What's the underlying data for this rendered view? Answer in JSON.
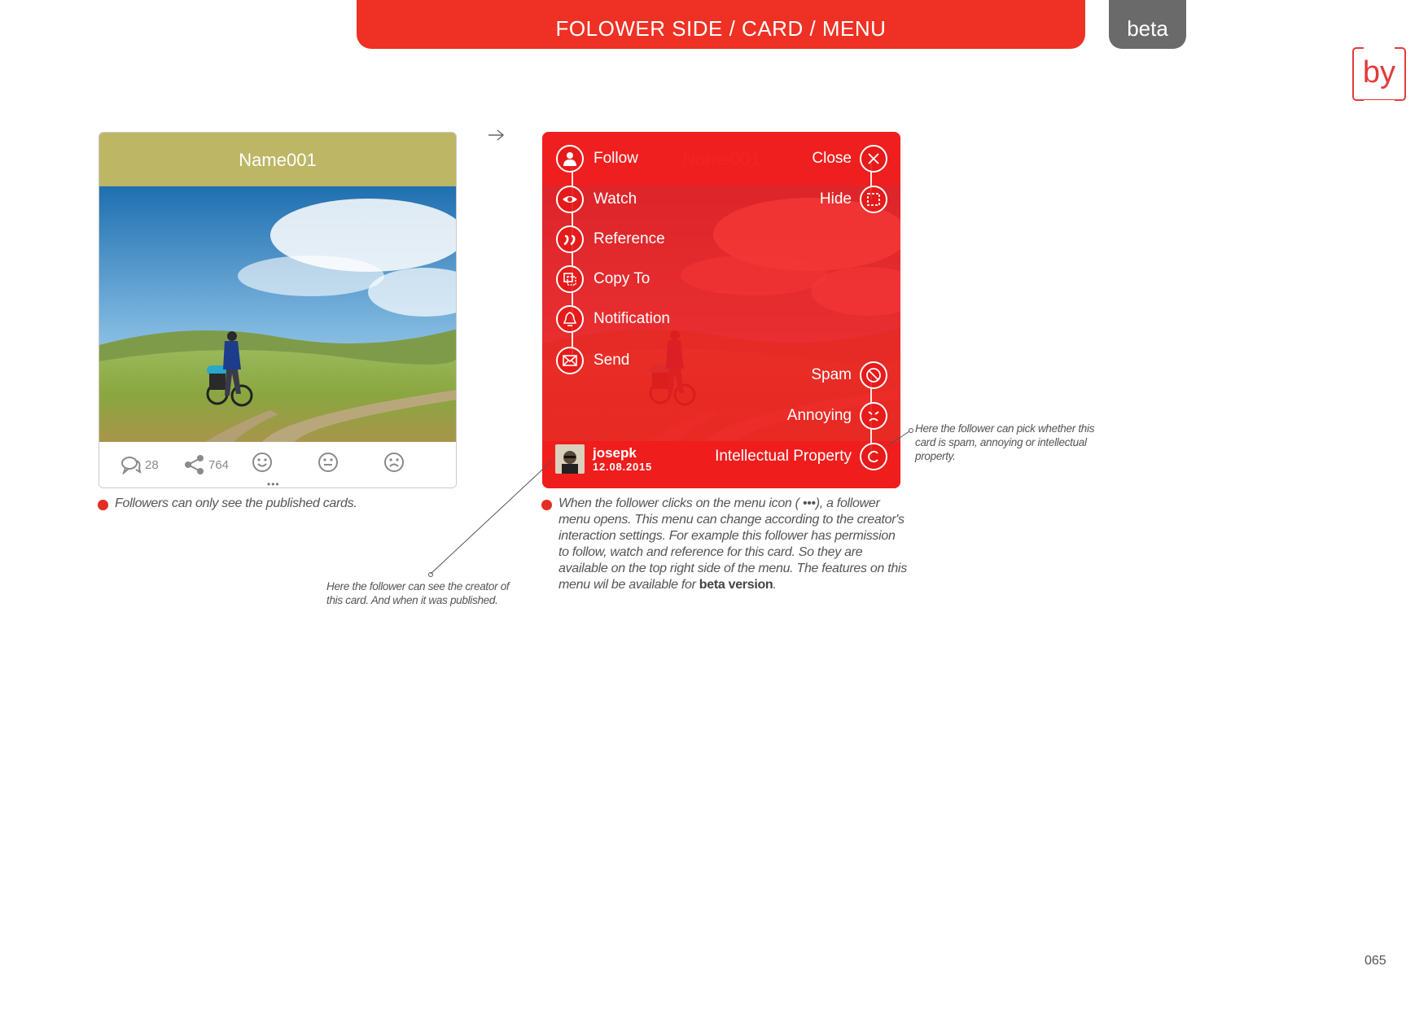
{
  "header": {
    "title": "FOLOWER SIDE / CARD / MENU",
    "beta_tab": "beta",
    "logo": "by"
  },
  "card": {
    "name": "Name001",
    "comments": "28",
    "shares": "764",
    "menu_dots": "•••"
  },
  "menu": {
    "left_items": [
      {
        "label": "Follow",
        "icon": "user-icon"
      },
      {
        "label": "Watch",
        "icon": "eye-icon"
      },
      {
        "label": "Reference",
        "icon": "quote-icon"
      },
      {
        "label": "Copy To",
        "icon": "copy-icon"
      },
      {
        "label": "Notification",
        "icon": "bell-icon"
      },
      {
        "label": "Send",
        "icon": "envelope-icon"
      }
    ],
    "right_items": [
      {
        "label": "Close",
        "icon": "close-icon"
      },
      {
        "label": "Hide",
        "icon": "hide-icon"
      },
      {
        "label": "Spam",
        "icon": "ban-icon"
      },
      {
        "label": "Annoying",
        "icon": "angry-face-icon"
      },
      {
        "label": "Intellectual Property",
        "icon": "copyright-icon"
      }
    ],
    "author": {
      "name": "josepk",
      "date": "12.08.2015"
    }
  },
  "captions": {
    "left": "Followers can only see the published cards.",
    "right_before": "When the follower clicks on the menu icon ( •••), a follower menu opens. This menu can change according to the creator's interaction settings. For example this follower has permission to follow, watch and reference for this card. So they are available on the top right side of the menu. The features on this menu wil be available for ",
    "right_bold": "beta version",
    "right_after": ".",
    "note_author": "Here the follower can see the creator of this card. And when it was published.",
    "note_report": "Here the follower can pick whether this card is spam, annoying or intellectual property."
  },
  "page_number": "065",
  "colors": {
    "accent": "#ee3124",
    "beta": "#6a6a6b",
    "card_head": "#bdb665"
  }
}
